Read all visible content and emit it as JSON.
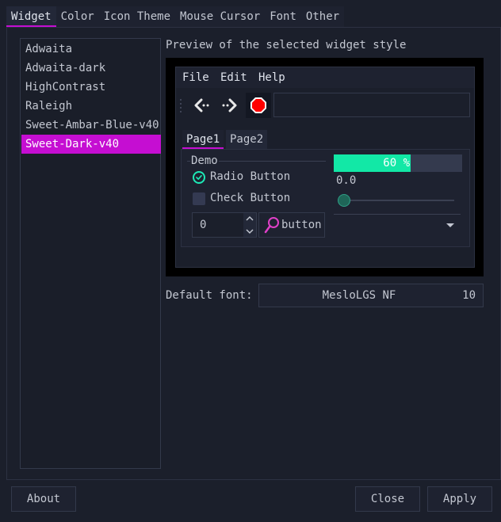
{
  "tabs": [
    "Widget",
    "Color",
    "Icon Theme",
    "Mouse Cursor",
    "Font",
    "Other"
  ],
  "active_tab": "Widget",
  "themes": [
    "Adwaita",
    "Adwaita-dark",
    "HighContrast",
    "Raleigh",
    "Sweet-Ambar-Blue-v40",
    "Sweet-Dark-v40"
  ],
  "selected_theme": "Sweet-Dark-v40",
  "preview_label": "Preview of the selected widget style",
  "preview": {
    "menu": [
      "File",
      "Edit",
      "Help"
    ],
    "toolbar_icons": [
      "back-icon",
      "forward-icon",
      "stop-icon"
    ],
    "toolbar_entry_value": "",
    "notebook_tabs": [
      "Page1",
      "Page2"
    ],
    "frame_label": "Demo",
    "radio_label": "Radio Button",
    "radio_checked": true,
    "check_label": "Check Button",
    "check_checked": false,
    "spin_value": "0",
    "button_label": "button",
    "progress_text": "60 %",
    "progress_fraction": 0.6,
    "scale_value": "0.0",
    "combo_value": ""
  },
  "default_font_label": "Default font:",
  "font_name": "MesloLGS NF",
  "font_size": "10",
  "buttons": {
    "about": "About",
    "close": "Close",
    "apply": "Apply"
  },
  "colors": {
    "accent": "#c50ed2",
    "progress": "#12e8a6",
    "background": "#1b1f2b",
    "stop": "#ff0000"
  }
}
